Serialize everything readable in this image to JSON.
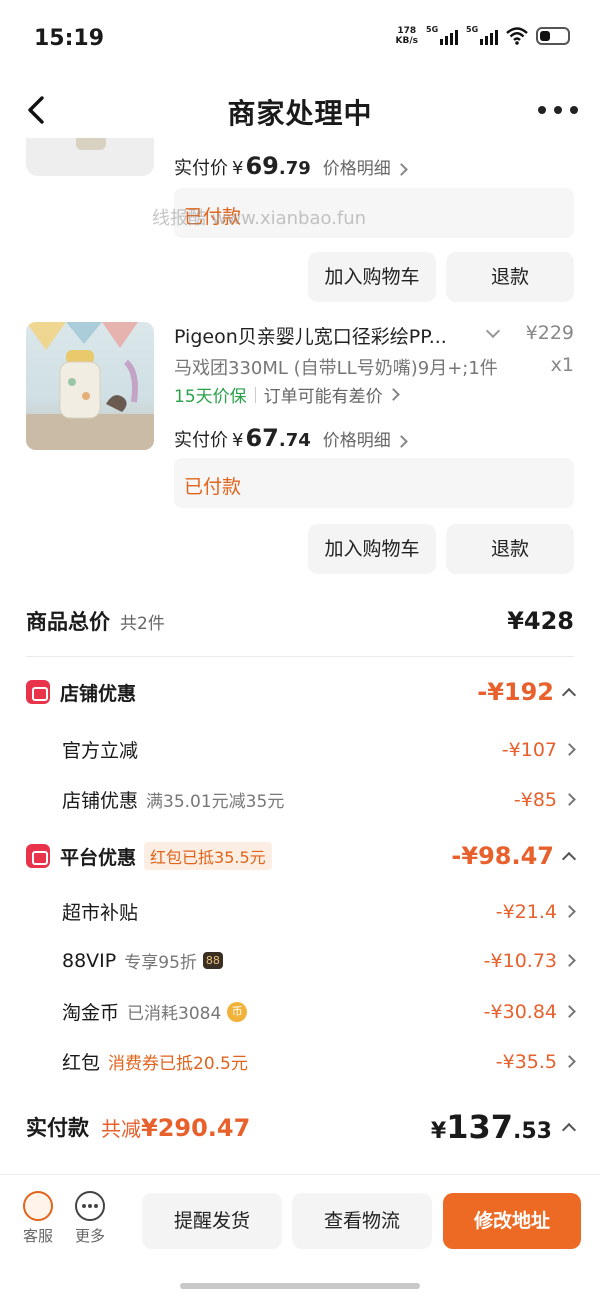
{
  "status": {
    "time": "15:19",
    "net_speed_value": "178",
    "net_speed_unit": "KB/s",
    "signal1": "5G",
    "signal2": "5G"
  },
  "nav": {
    "title": "商家处理中"
  },
  "item1": {
    "actual_price_label": "实付价",
    "currency": "¥",
    "price_main": "69",
    "price_dec": ".79",
    "price_detail": "价格明细",
    "paid_status": "已付款",
    "watermark": "线报酷 www.xianbao.fun",
    "add_cart": "加入购物车",
    "refund": "退款"
  },
  "item2": {
    "title": "Pigeon贝亲婴儿宽口径彩绘PP...",
    "spec": "马戏团330ML (自带LL号奶嘴)9月+;1件",
    "price": "¥229",
    "qty": "x1",
    "guarantee": "15天价保",
    "guarantee_note": "订单可能有差价",
    "actual_price_label": "实付价",
    "currency": "¥",
    "price_main": "67",
    "price_dec": ".74",
    "price_detail": "价格明细",
    "paid_status": "已付款",
    "add_cart": "加入购物车",
    "refund": "退款"
  },
  "summary": {
    "label": "商品总价",
    "count": "共2件",
    "value": "¥428"
  },
  "store_discount": {
    "title": "店铺优惠",
    "value": "-¥192",
    "rows": [
      {
        "label": "官方立减",
        "note": "",
        "value": "-¥107"
      },
      {
        "label": "店铺优惠",
        "note": "满35.01元减35元",
        "value": "-¥85"
      }
    ]
  },
  "platform_discount": {
    "title": "平台优惠",
    "tag": "红包已抵35.5元",
    "value": "-¥98.47",
    "rows": [
      {
        "label": "超市补贴",
        "note": "",
        "value": "-¥21.4"
      },
      {
        "label": "88VIP",
        "note": "专享95折",
        "badge": "88",
        "value": "-¥10.73"
      },
      {
        "label": "淘金币",
        "note": "已消耗3084",
        "coin": "币",
        "value": "-¥30.84"
      },
      {
        "label": "红包",
        "note": "消费券已抵20.5元",
        "value": "-¥35.5"
      }
    ]
  },
  "total": {
    "label": "实付款",
    "reduce_prefix": "共减",
    "reduce_value": "¥290.47",
    "currency": "¥",
    "main": "137",
    "dec": ".53"
  },
  "bottom": {
    "service": "客服",
    "more": "更多",
    "remind": "提醒发货",
    "logistics": "查看物流",
    "modify_address": "修改地址"
  },
  "colors": {
    "accent_orange": "#ed6a25",
    "discount_red": "#e8334a",
    "green": "#2aa14a"
  }
}
